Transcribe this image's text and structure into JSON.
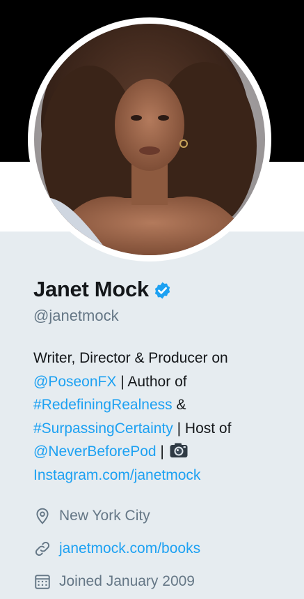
{
  "profile": {
    "name": "Janet Mock",
    "handle": "@janetmock",
    "avatar": "profile-photo",
    "verified_icon": "verified-badge-icon",
    "colors": {
      "link": "#1da1f2",
      "text": "#14171a",
      "muted": "#657786",
      "background": "#e6ecf0",
      "header": "#000000"
    }
  },
  "bio": {
    "text1": "Writer, Director & Producer on",
    "mention1": "@PoseonFX",
    "text2": " | Author of",
    "hashtag1": "#RedefiningRealness",
    "text3": " &",
    "hashtag2": "#SurpassingCertainty",
    "text4": " | Host of",
    "mention2": "@NeverBeforePod",
    "text5": " | ",
    "camera_icon": "camera-emoji-icon",
    "link": "Instagram.com/janetmock"
  },
  "meta": {
    "location": "New York City",
    "location_icon": "location-pin-icon",
    "website": "janetmock.com/books",
    "website_icon": "link-icon",
    "joined": "Joined January 2009",
    "joined_icon": "calendar-icon"
  }
}
